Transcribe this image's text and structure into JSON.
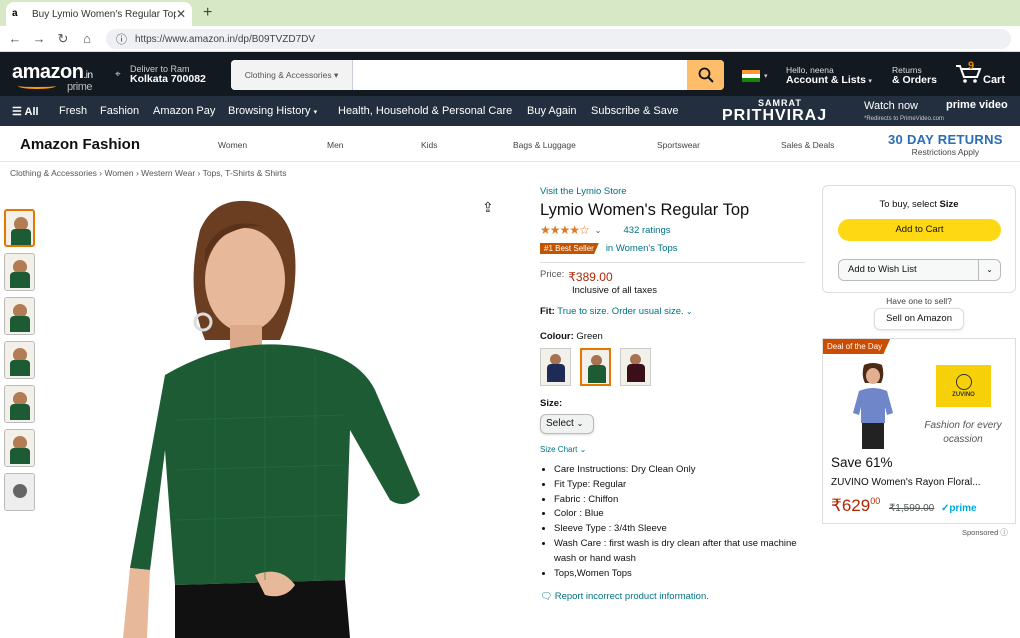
{
  "browser": {
    "tab_title": "Buy Lymio Women's Regular Top",
    "tab_favicon": "a",
    "new_tab": "+",
    "url": "https://www.amazon.in/dp/B09TVZD7DV"
  },
  "header": {
    "logo": "amazon",
    "logo_suffix": ".in",
    "logo_sub": "prime",
    "deliver_line1": "Deliver to Ram",
    "deliver_line2": "Kolkata 700082",
    "search_category": "Clothing & Accessories",
    "search_placeholder": "",
    "account_line1": "Hello, neena",
    "account_line2": "Account & Lists",
    "orders_line1": "Returns",
    "orders_line2": "& Orders",
    "cart_count": "9",
    "cart_label": "Cart"
  },
  "subnav": {
    "items": [
      "All",
      "Fresh",
      "Fashion",
      "Amazon Pay",
      "Browsing History",
      "Health, Household & Personal Care",
      "Buy Again",
      "Subscribe & Save"
    ],
    "promo_top": "SAMRAT",
    "promo_title": "PRITHVIRAJ",
    "promo_watch": "Watch now",
    "promo_service": "prime video",
    "promo_small": "*Redirects to PrimeVideo.com"
  },
  "fashion_bar": {
    "brand": "Amazon Fashion",
    "links": [
      "Women",
      "Men",
      "Kids",
      "Bags & Luggage",
      "Sportswear",
      "Sales & Deals"
    ],
    "returns_title": "30 DAY RETURNS",
    "returns_sub": "Restrictions Apply"
  },
  "breadcrumb": "Clothing & Accessories › Women › Western Wear › Tops, T-Shirts & Shirts",
  "product": {
    "store_link": "Visit the Lymio Store",
    "title": "Lymio Women's Regular Top",
    "rating": 4.5,
    "stars": "★★★★☆",
    "ratings_count": "432 ratings",
    "best_seller": "#1 Best Seller",
    "best_seller_cat": "in Women's Tops",
    "price_label": "Price:",
    "price": "₹389.00",
    "taxes": "Inclusive of all taxes",
    "fit_label": "Fit:",
    "fit_value": "True to size. Order usual size.",
    "colour_label": "Colour:",
    "colour_value": "Green",
    "size_label": "Size:",
    "size_select": "Select",
    "size_chart": "Size Chart",
    "bullets": [
      "Care Instructions: Dry Clean Only",
      "Fit Type: Regular",
      "Fabric : Chiffon",
      "Color : Blue",
      "Sleeve Type : 3/4th Sleeve",
      "Wash Care : first wash is dry clean after that use machine wash or hand wash",
      "Tops,Women Tops"
    ],
    "report": "Report incorrect product information."
  },
  "buybox": {
    "prompt_prefix": "To buy, select",
    "prompt_bold": "Size",
    "add_to_cart": "Add to Cart",
    "wish_list": "Add to Wish List",
    "sell_question": "Have one to sell?",
    "sell_button": "Sell on Amazon"
  },
  "ad": {
    "deal_badge": "Deal of the Day",
    "brand_logo": "ZUVINO",
    "tagline": "Fashion for every ocassion",
    "save": "Save 61%",
    "name": "ZUVINO Women's Rayon Floral...",
    "price_whole": "₹629",
    "price_fraction": "00",
    "price_old": "₹1,599.00",
    "prime_badge": "✓prime",
    "sponsored": "Sponsored"
  },
  "colors": {
    "amazon_dark": "#131921",
    "amazon_subnav": "#232f3e",
    "search_button": "#febd69",
    "cart_button": "#ffd814",
    "link": "#007185",
    "price_red": "#b12704",
    "best_seller": "#c45500",
    "product_green": "#1c5b33"
  }
}
